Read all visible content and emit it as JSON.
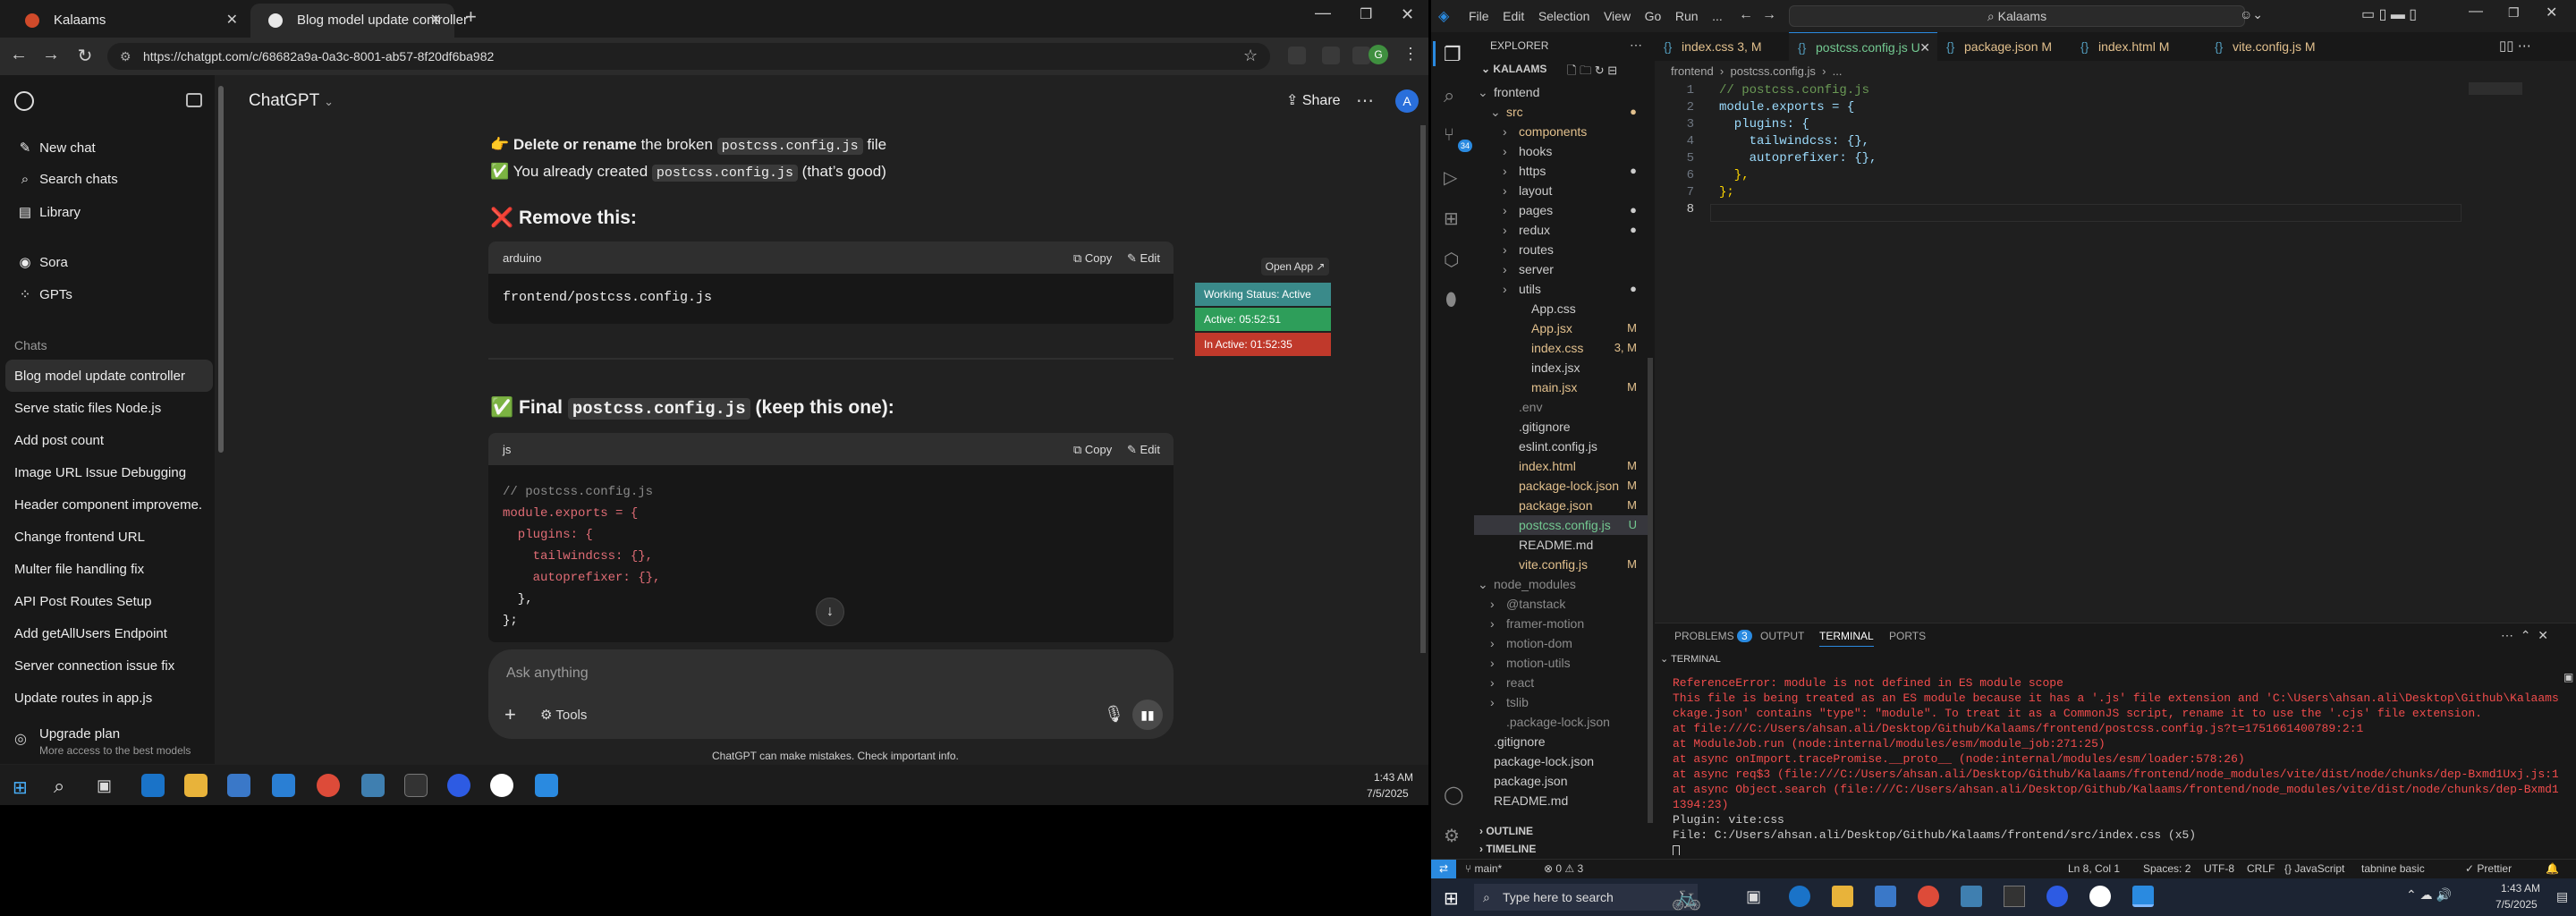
{
  "chrome": {
    "tabs": [
      {
        "title": "Kalaams",
        "active": false
      },
      {
        "title": "Blog model update controller",
        "active": true
      }
    ],
    "url": "https://chatgpt.com/c/68682a9a-0a3c-8001-ab57-8f20df6ba982"
  },
  "sidebar": {
    "nav": [
      {
        "label": "New chat",
        "icon": "pencil-icon"
      },
      {
        "label": "Search chats",
        "icon": "search-icon"
      },
      {
        "label": "Library",
        "icon": "library-icon"
      }
    ],
    "apps": [
      {
        "label": "Sora",
        "icon": "sora-icon"
      },
      {
        "label": "GPTs",
        "icon": "gpts-icon"
      }
    ],
    "chats_header": "Chats",
    "chats": [
      "Blog model update controller",
      "Serve static files Node.js",
      "Add post count",
      "Image URL Issue Debugging",
      "Header component improveme...",
      "Change frontend URL",
      "Multer file handling fix",
      "API Post Routes Setup",
      "Add getAllUsers Endpoint",
      "Server connection issue fix",
      "Update routes in app.js"
    ],
    "upgrade_title": "Upgrade plan",
    "upgrade_sub": "More access to the best models"
  },
  "header": {
    "model": "ChatGPT",
    "share": "Share",
    "avatar": "A"
  },
  "content": {
    "delete_line_pre": "Delete or rename",
    "delete_line_mid": " the broken ",
    "delete_code": "postcss.config.js",
    "delete_line_post": " file",
    "created_pre": "You already created ",
    "created_code": "postcss.config.js",
    "created_post": " (that’s good)",
    "remove_heading": "Remove this:",
    "block1_lang": "arduino",
    "block1_code": "frontend/postcss.config.js",
    "copy": "Copy",
    "edit": "Edit",
    "final_pre": "Final ",
    "final_code": "postcss.config.js",
    "final_post": " (keep this one):",
    "block2_lang": "js",
    "block2_lines": [
      "// postcss.config.js",
      "module.exports = {",
      "  plugins: {",
      "    tailwindcss: {},",
      "    autoprefixer: {},",
      "  },",
      "};"
    ]
  },
  "composer": {
    "placeholder": "Ask anything",
    "tools": "Tools",
    "disclaimer": "ChatGPT can make mistakes. Check important info."
  },
  "widget": {
    "open_app": "Open App ↗",
    "status": "Working Status: Active",
    "active": "Active: 05:52:51",
    "inactive": "In Active: 01:52:35",
    "colors": {
      "status": "#3a8a8a",
      "active": "#2e9e5a",
      "inactive": "#c0392b"
    }
  },
  "taskbar_left": {
    "time": "1:43 AM",
    "date": "7/5/2025"
  },
  "vscode": {
    "menu": [
      "File",
      "Edit",
      "Selection",
      "View",
      "Go",
      "Run",
      "..."
    ],
    "search": "Kalaams",
    "explorer_title": "EXPLORER",
    "project": "KALAAMS",
    "tree": [
      {
        "label": "frontend",
        "indent": 1,
        "type": "folder-open",
        "color": "#cccccc"
      },
      {
        "label": "src",
        "indent": 2,
        "type": "folder-open",
        "color": "#e2c08d",
        "mark": "●"
      },
      {
        "label": "components",
        "indent": 3,
        "type": "folder",
        "color": "#e2c08d",
        "mark": ""
      },
      {
        "label": "hooks",
        "indent": 3,
        "type": "folder",
        "color": "#cccccc"
      },
      {
        "label": "https",
        "indent": 3,
        "type": "folder",
        "color": "#cccccc",
        "mark": "●"
      },
      {
        "label": "layout",
        "indent": 3,
        "type": "folder",
        "color": "#cccccc"
      },
      {
        "label": "pages",
        "indent": 3,
        "type": "folder",
        "color": "#cccccc",
        "mark": "●"
      },
      {
        "label": "redux",
        "indent": 3,
        "type": "folder",
        "color": "#cccccc",
        "mark": "●"
      },
      {
        "label": "routes",
        "indent": 3,
        "type": "folder",
        "color": "#cccccc"
      },
      {
        "label": "server",
        "indent": 3,
        "type": "folder",
        "color": "#cccccc"
      },
      {
        "label": "utils",
        "indent": 3,
        "type": "folder",
        "color": "#cccccc",
        "mark": "●"
      },
      {
        "label": "App.css",
        "indent": 4,
        "type": "file",
        "color": "#cccccc"
      },
      {
        "label": "App.jsx",
        "indent": 4,
        "type": "file",
        "color": "#e2c08d",
        "mark": "M"
      },
      {
        "label": "index.css",
        "indent": 4,
        "type": "file",
        "color": "#e2c08d",
        "mark": "3, M"
      },
      {
        "label": "index.jsx",
        "indent": 4,
        "type": "file",
        "color": "#cccccc"
      },
      {
        "label": "main.jsx",
        "indent": 4,
        "type": "file",
        "color": "#e2c08d",
        "mark": "M"
      },
      {
        "label": ".env",
        "indent": 3,
        "type": "file",
        "color": "#8b8b8b"
      },
      {
        "label": ".gitignore",
        "indent": 3,
        "type": "file",
        "color": "#cccccc"
      },
      {
        "label": "eslint.config.js",
        "indent": 3,
        "type": "file",
        "color": "#cccccc"
      },
      {
        "label": "index.html",
        "indent": 3,
        "type": "file",
        "color": "#e2c08d",
        "mark": "M"
      },
      {
        "label": "package-lock.json",
        "indent": 3,
        "type": "file",
        "color": "#e2c08d",
        "mark": "M"
      },
      {
        "label": "package.json",
        "indent": 3,
        "type": "file",
        "color": "#e2c08d",
        "mark": "M"
      },
      {
        "label": "postcss.config.js",
        "indent": 3,
        "type": "file",
        "color": "#73c991",
        "mark": "U",
        "selected": true
      },
      {
        "label": "README.md",
        "indent": 3,
        "type": "file",
        "color": "#cccccc"
      },
      {
        "label": "vite.config.js",
        "indent": 3,
        "type": "file",
        "color": "#e2c08d",
        "mark": "M"
      },
      {
        "label": "node_modules",
        "indent": 1,
        "type": "folder-open",
        "color": "#8b8b8b"
      },
      {
        "label": "@tanstack",
        "indent": 2,
        "type": "folder",
        "color": "#8b8b8b"
      },
      {
        "label": "framer-motion",
        "indent": 2,
        "type": "folder",
        "color": "#8b8b8b"
      },
      {
        "label": "motion-dom",
        "indent": 2,
        "type": "folder",
        "color": "#8b8b8b"
      },
      {
        "label": "motion-utils",
        "indent": 2,
        "type": "folder",
        "color": "#8b8b8b"
      },
      {
        "label": "react",
        "indent": 2,
        "type": "folder",
        "color": "#8b8b8b"
      },
      {
        "label": "tslib",
        "indent": 2,
        "type": "folder",
        "color": "#8b8b8b"
      },
      {
        "label": ".package-lock.json",
        "indent": 2,
        "type": "file",
        "color": "#8b8b8b"
      },
      {
        "label": ".gitignore",
        "indent": 1,
        "type": "file",
        "color": "#cccccc"
      },
      {
        "label": "package-lock.json",
        "indent": 1,
        "type": "file",
        "color": "#cccccc"
      },
      {
        "label": "package.json",
        "indent": 1,
        "type": "file",
        "color": "#cccccc"
      },
      {
        "label": "README.md",
        "indent": 1,
        "type": "file",
        "color": "#cccccc"
      }
    ],
    "outline": "OUTLINE",
    "timeline": "TIMELINE",
    "tabs": [
      {
        "label": "index.css 3, M",
        "color": "#e2c08d"
      },
      {
        "label": "postcss.config.js U",
        "color": "#73c991",
        "active": true
      },
      {
        "label": "package.json M",
        "color": "#e2c08d"
      },
      {
        "label": "index.html M",
        "color": "#e2c08d"
      },
      {
        "label": "vite.config.js M",
        "color": "#e2c08d"
      }
    ],
    "breadcrumb": "frontend  ›  postcss.config.js  ›  ...",
    "code": [
      "// postcss.config.js",
      "module.exports = {",
      "  plugins: {",
      "    tailwindcss: {},",
      "    autoprefixer: {},",
      "  },",
      "};",
      ""
    ],
    "panel_tabs": [
      "PROBLEMS",
      "OUTPUT",
      "TERMINAL",
      "PORTS"
    ],
    "problems_count": "3",
    "terminal_label": "TERMINAL",
    "terminal": [
      "ReferenceError: module is not defined in ES module scope",
      "This file is being treated as an ES module because it has a '.js' file extension and 'C:\\Users\\ahsan.ali\\Desktop\\Github\\Kalaams\\frontend\\pa",
      "ckage.json' contains \"type\": \"module\". To treat it as a CommonJS script, rename it to use the '.cjs' file extension.",
      "    at file:///C:/Users/ahsan.ali/Desktop/Github/Kalaams/frontend/postcss.config.js?t=1751661400789:2:1",
      "    at ModuleJob.run (node:internal/modules/esm/module_job:271:25)",
      "    at async onImport.tracePromise.__proto__ (node:internal/modules/esm/loader:578:26)",
      "    at async req$3 (file:///C:/Users/ahsan.ali/Desktop/Github/Kalaams/frontend/node_modules/vite/dist/node/chunks/dep-Bxmd1Uxj.js:11652:13)",
      "    at async Object.search (file:///C:/Users/ahsan.ali/Desktop/Github/Kalaams/frontend/node_modules/vite/dist/node/chunks/dep-Bxmd1Uxj.js:1",
      "1394:23)",
      "  Plugin: vite:css",
      "  File: C:/Users/ahsan.ali/Desktop/Github/Kalaams/frontend/src/index.css (x5)"
    ],
    "status": {
      "branch": "main*",
      "errors": "⊗ 0 ⚠ 3",
      "position": "Ln 8, Col 1",
      "spaces": "Spaces: 2",
      "encoding": "UTF-8",
      "eol": "CRLF",
      "lang": "{} JavaScript",
      "tabnine": "tabnine basic",
      "prettier": "✓ Prettier"
    }
  },
  "taskbar_right": {
    "search": "Type here to search",
    "time": "1:43 AM",
    "date": "7/5/2025"
  }
}
